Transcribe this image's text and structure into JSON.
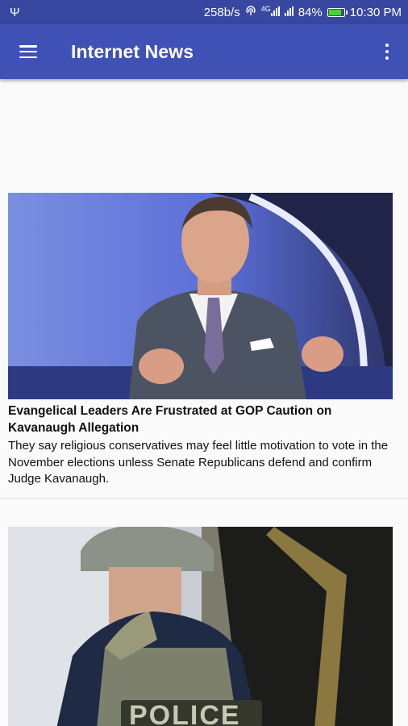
{
  "status_bar": {
    "net_speed": "258b/s",
    "network_type": "4G",
    "battery": "84%",
    "battery_level": 0.84,
    "time": "10:30 PM",
    "icons": [
      "usb-icon",
      "hotspot-icon",
      "signal-icon",
      "battery-icon"
    ]
  },
  "app_bar": {
    "title": "Internet News",
    "color": "#3f51b5",
    "icons": [
      "menu-icon",
      "overflow-menu-icon"
    ]
  },
  "articles": [
    {
      "headline": "Evangelical Leaders Are Frustrated at GOP Caution on Kavanaugh Allegation",
      "summary": "They say religious conservatives may feel little motivation to vote in the November elections unless Senate Republicans defend and confirm Judge Kavanaugh."
    },
    {
      "image_label": "POLICE"
    }
  ]
}
